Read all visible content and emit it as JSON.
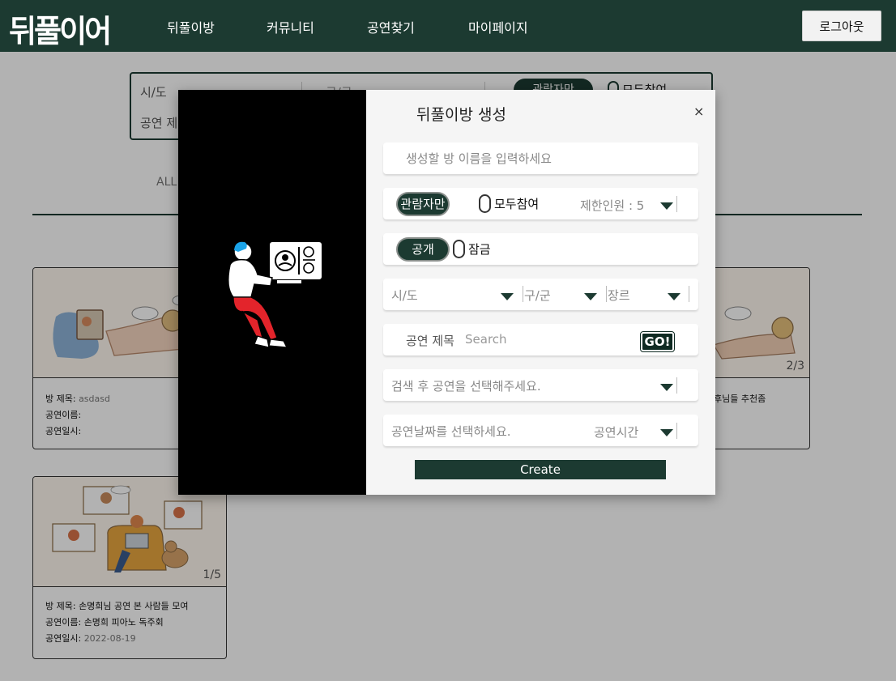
{
  "header": {
    "logo": "뒤풀이어",
    "nav": [
      "뒤풀이방",
      "커뮤니티",
      "공연찾기",
      "마이페이지"
    ],
    "logout_label": "로그아웃"
  },
  "filter": {
    "sido": "시/도",
    "gugun": "구/구",
    "audience_only": "관람자만",
    "all_participate": "모두참여",
    "title_search": "공연 제"
  },
  "categories": {
    "all": "ALL"
  },
  "rooms": [
    {
      "page": "",
      "title_label": "방 제목:",
      "title": "asdasd",
      "show_label": "공연이름:",
      "show": "",
      "date_label": "공연일시:",
      "date": ""
    },
    {
      "page": "2/3",
      "title_fragment": "후님들 추천좀"
    },
    {
      "page": "1/5",
      "title_label": "방 제목:",
      "title": "손명희님 공연 본 사람들 모여",
      "show_label": "공연이름:",
      "show": "손명희 피아노 독주회",
      "date_label": "공연일시:",
      "date": "2022-08-19"
    }
  ],
  "modal": {
    "title": "뒤풀이방 생성",
    "close": "×",
    "room_name_placeholder": "생성할 방 이름을 입력하세요",
    "audience_only": "관람자만",
    "all_participate": "모두참여",
    "limit": "제한인원 : 5",
    "public": "공개",
    "locked": "잠금",
    "sido": "시/도",
    "gugun": "구/군",
    "genre": "장르",
    "show_title_label": "공연 제목",
    "search_placeholder": "Search",
    "go": "GO!",
    "select_show": "검색 후 공연을 선택해주세요.",
    "select_date": "공연날짜를 선택하세요.",
    "show_time": "공연시간",
    "create": "Create"
  },
  "colors": {
    "brand_dark_green": "#1c3a31",
    "modal_panel": "#f5f5f5",
    "illustration_blue": "#1aa3e8",
    "illustration_red": "#e3242b"
  }
}
